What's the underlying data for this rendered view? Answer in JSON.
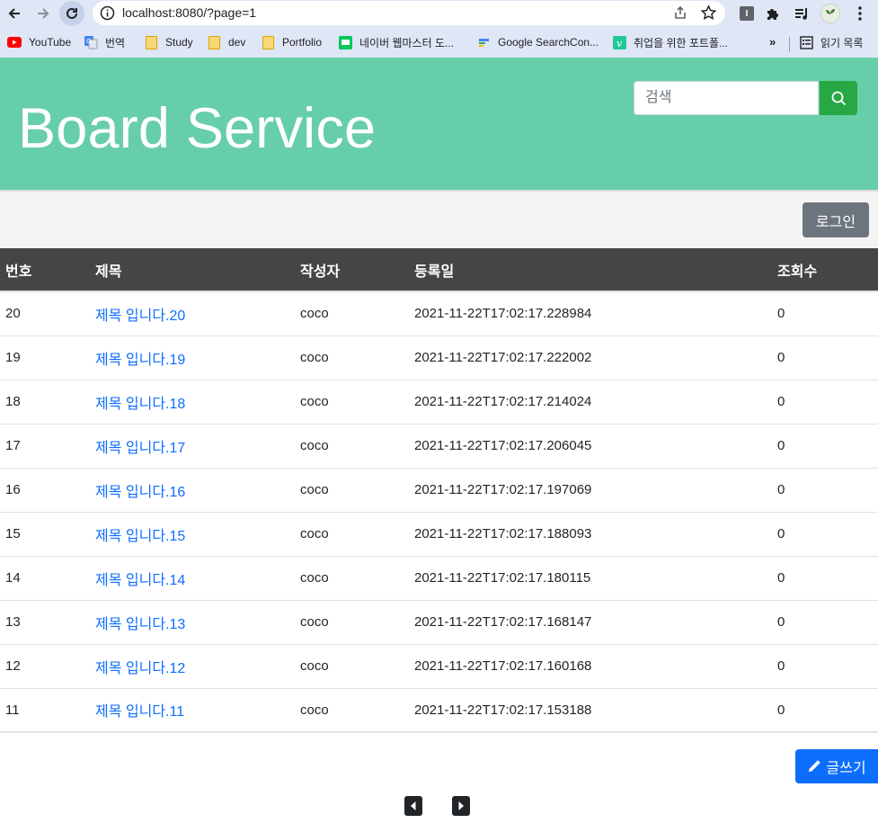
{
  "browser": {
    "url": "localhost:8080/?page=1",
    "bookmarks": [
      {
        "label": "YouTube",
        "icon": "youtube-icon"
      },
      {
        "label": "번역",
        "icon": "translate-icon"
      },
      {
        "label": "Study",
        "icon": "folder-icon"
      },
      {
        "label": "dev",
        "icon": "folder-icon"
      },
      {
        "label": "Portfolio",
        "icon": "folder-icon"
      },
      {
        "label": "네이버 웹마스터 도...",
        "icon": "naver-webmaster-icon"
      },
      {
        "label": "Google SearchCon...",
        "icon": "google-search-console-icon"
      },
      {
        "label": "취업을 위한 포트폴...",
        "icon": "velog-icon"
      }
    ],
    "bookmarks_more": "»",
    "reading_list": "읽기 목록"
  },
  "header": {
    "title": "Board Service",
    "search_placeholder": "검색"
  },
  "auth": {
    "login_label": "로그인"
  },
  "table": {
    "columns": [
      "번호",
      "제목",
      "작성자",
      "등록일",
      "조회수"
    ],
    "rows": [
      {
        "no": "20",
        "title": "제목 입니다.20",
        "writer": "coco",
        "date": "2021-11-22T17:02:17.228984",
        "views": "0"
      },
      {
        "no": "19",
        "title": "제목 입니다.19",
        "writer": "coco",
        "date": "2021-11-22T17:02:17.222002",
        "views": "0"
      },
      {
        "no": "18",
        "title": "제목 입니다.18",
        "writer": "coco",
        "date": "2021-11-22T17:02:17.214024",
        "views": "0"
      },
      {
        "no": "17",
        "title": "제목 입니다.17",
        "writer": "coco",
        "date": "2021-11-22T17:02:17.206045",
        "views": "0"
      },
      {
        "no": "16",
        "title": "제목 입니다.16",
        "writer": "coco",
        "date": "2021-11-22T17:02:17.197069",
        "views": "0"
      },
      {
        "no": "15",
        "title": "제목 입니다.15",
        "writer": "coco",
        "date": "2021-11-22T17:02:17.188093",
        "views": "0"
      },
      {
        "no": "14",
        "title": "제목 입니다.14",
        "writer": "coco",
        "date": "2021-11-22T17:02:17.180115",
        "views": "0"
      },
      {
        "no": "13",
        "title": "제목 입니다.13",
        "writer": "coco",
        "date": "2021-11-22T17:02:17.168147",
        "views": "0"
      },
      {
        "no": "12",
        "title": "제목 입니다.12",
        "writer": "coco",
        "date": "2021-11-22T17:02:17.160168",
        "views": "0"
      },
      {
        "no": "11",
        "title": "제목 입니다.11",
        "writer": "coco",
        "date": "2021-11-22T17:02:17.153188",
        "views": "0"
      }
    ]
  },
  "actions": {
    "write_label": "글쓰기"
  },
  "pagination": {
    "prev_icon": "caret-left-square-icon",
    "next_icon": "caret-right-square-icon"
  },
  "colors": {
    "hero": "#67ceaa",
    "search_button": "#28a745",
    "login_button": "#6c757d",
    "table_header": "#454545",
    "link": "#0d6efd",
    "write_button": "#0d6efd"
  }
}
